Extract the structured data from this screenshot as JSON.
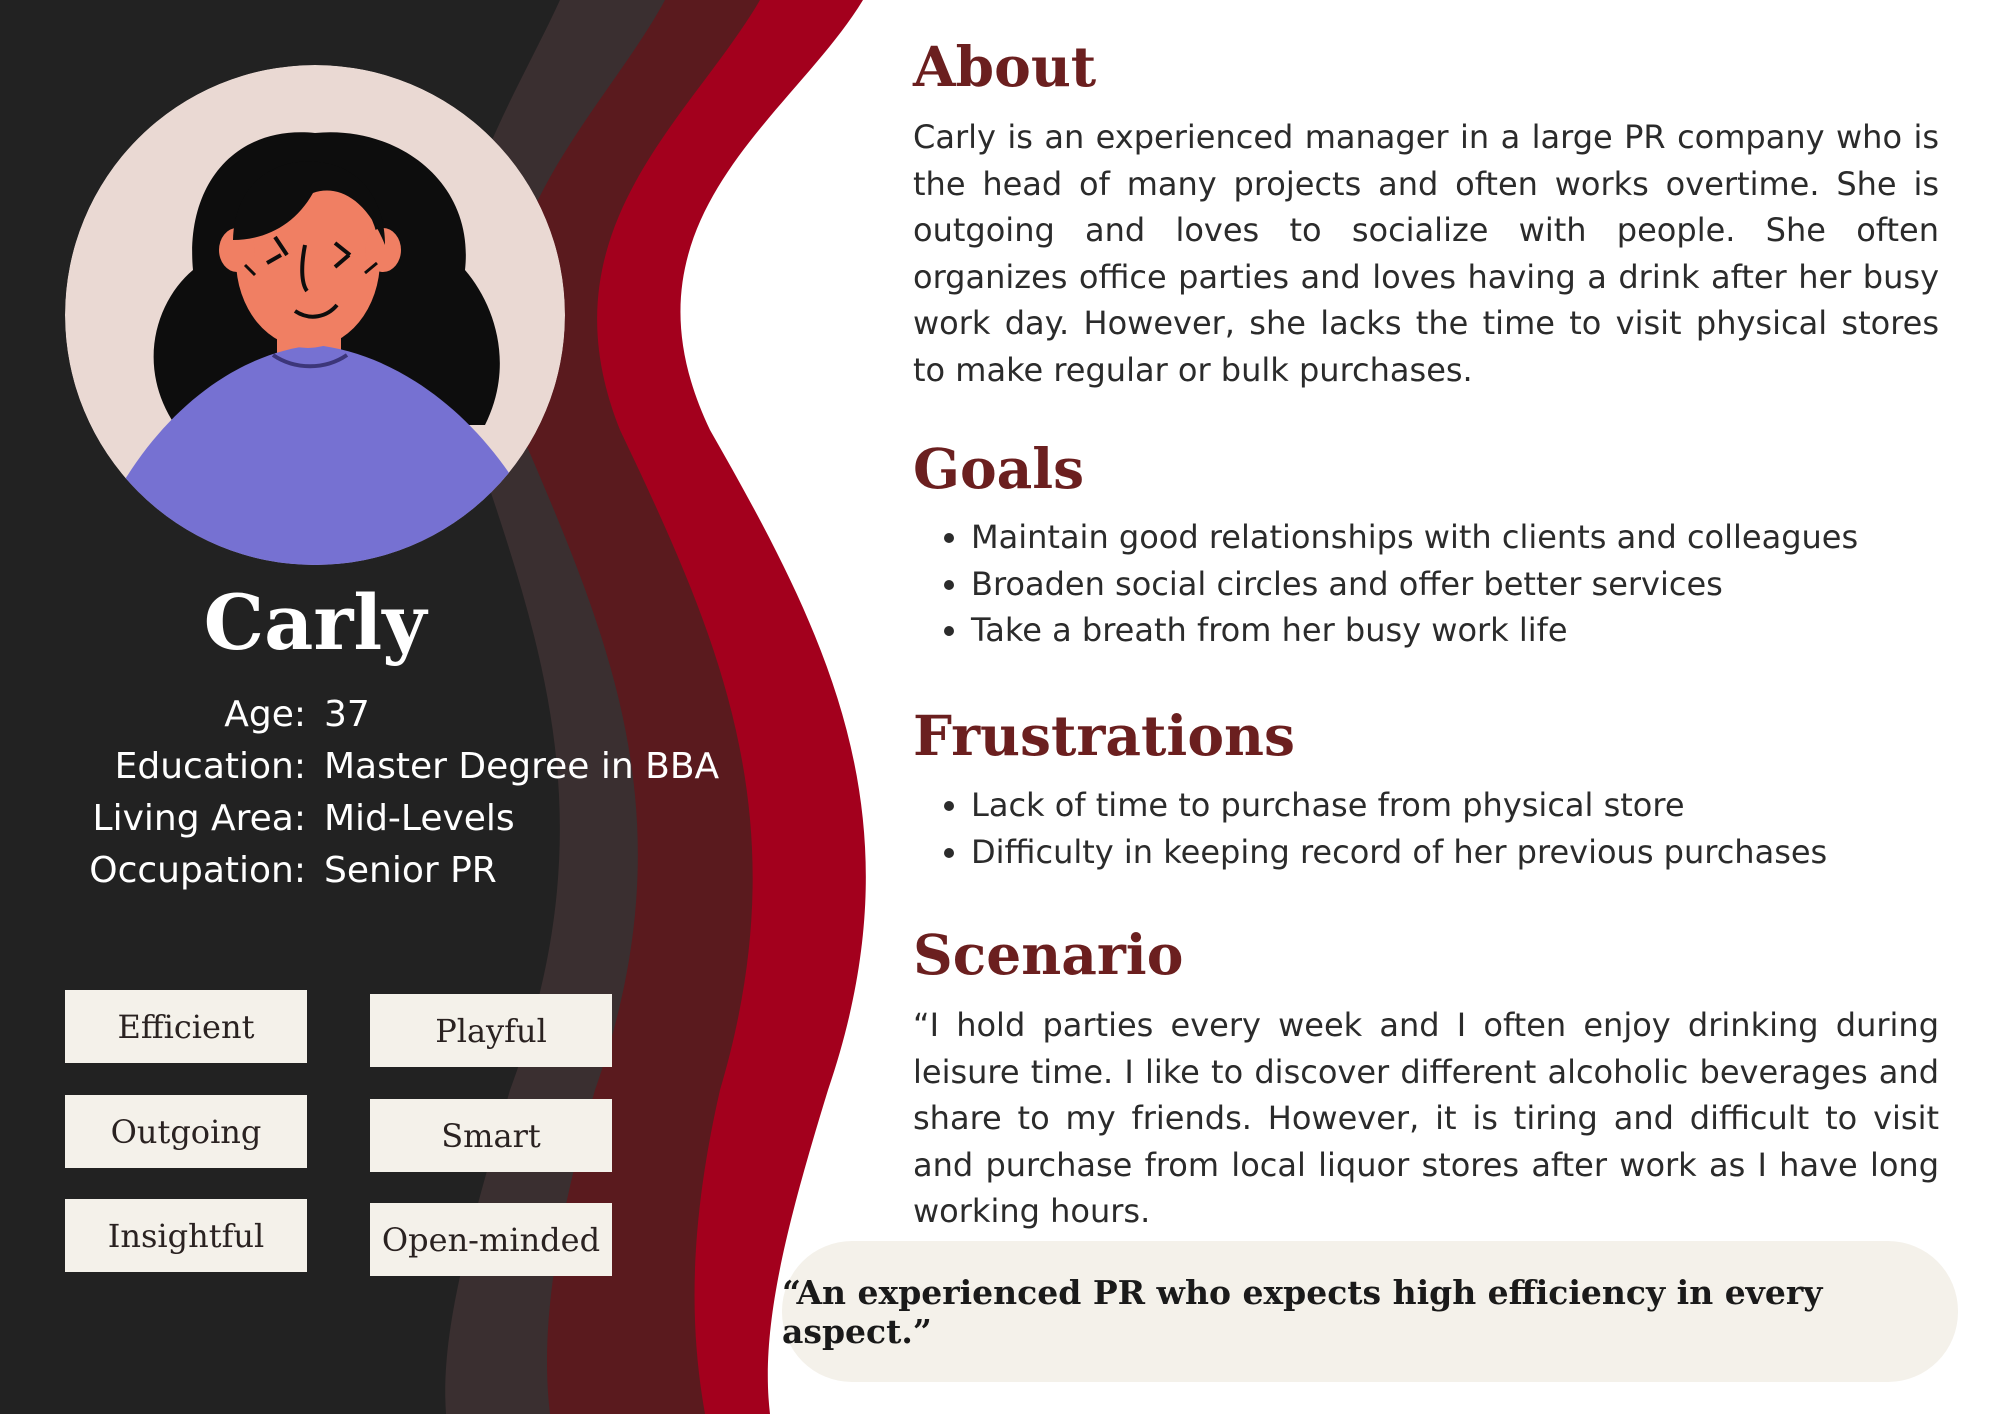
{
  "colors": {
    "dark": "#222222",
    "band_gray": "#3a2f30",
    "band_maroon": "#5a1a1e",
    "band_red": "#a3001d",
    "heading": "#6b1f1f",
    "chip": "#f4f1ea",
    "avatar_bg": "#ead9d3",
    "shirt": "#7671d2",
    "skin": "#f07f63"
  },
  "profile": {
    "name": "Carly",
    "info": [
      {
        "label": "Age:",
        "value": "37"
      },
      {
        "label": "Education:",
        "value": "Master Degree in BBA"
      },
      {
        "label": "Living Area:",
        "value": "Mid-Levels"
      },
      {
        "label": "Occupation:",
        "value": "Senior PR"
      }
    ],
    "traits": [
      "Efficient",
      "Playful",
      "Outgoing",
      "Smart",
      "Insightful",
      "Open-minded"
    ]
  },
  "about": {
    "title": "About",
    "text": "Carly is an experienced manager in a large PR company who is the head of many projects and often works overtime. She is outgoing and loves to socialize with people. She often organizes office parties and loves having a drink after her busy work day. However, she lacks the time to visit physical stores to make regular or bulk purchases."
  },
  "goals": {
    "title": "Goals",
    "items": [
      "Maintain good relationships with clients and colleagues",
      "Broaden social circles and offer better services",
      "Take a breath from her busy work life"
    ]
  },
  "frustrations": {
    "title": "Frustrations",
    "items": [
      "Lack of time to purchase from physical store",
      "Difficulty in keeping record of her previous purchases"
    ]
  },
  "scenario": {
    "title": "Scenario",
    "text": "“I hold parties every week and I often enjoy drinking during leisure time. I like to discover different alcoholic beverages and share to my friends. However, it is tiring and difficult to visit and purchase from local liquor stores after work as I have long working hours."
  },
  "quote": "“An experienced PR who expects high efficiency in every aspect.”"
}
